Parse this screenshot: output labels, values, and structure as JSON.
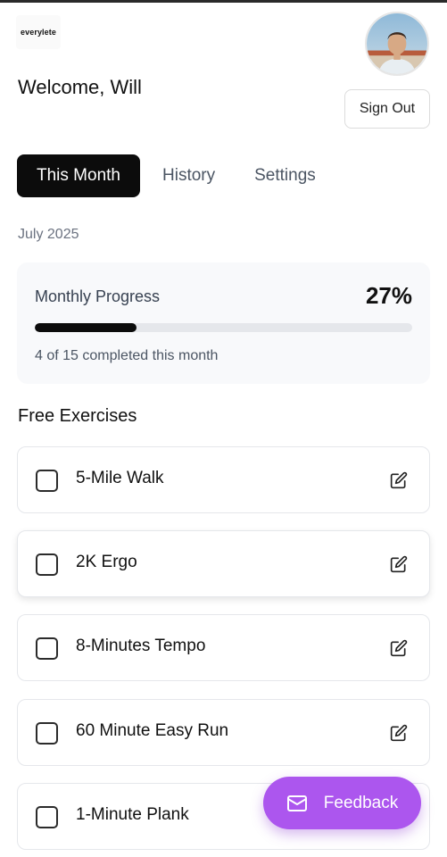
{
  "app": {
    "logo_text": "everylete"
  },
  "header": {
    "welcome": "Welcome, Will",
    "sign_out_label": "Sign Out",
    "avatar_icon": "user-avatar-photo"
  },
  "tabs": [
    {
      "label": "This Month",
      "active": true
    },
    {
      "label": "History",
      "active": false
    },
    {
      "label": "Settings",
      "active": false
    }
  ],
  "month_label": "July 2025",
  "progress": {
    "title": "Monthly Progress",
    "percent_text": "27%",
    "percent_value": 27,
    "completed_text": "4 of 15 completed this month"
  },
  "free_exercises": {
    "title": "Free Exercises",
    "items": [
      {
        "name": "5-Mile Walk",
        "checked": false,
        "icon": "edit-icon"
      },
      {
        "name": "2K Ergo",
        "checked": false,
        "icon": "edit-icon"
      },
      {
        "name": "8-Minutes Tempo",
        "checked": false,
        "icon": "edit-icon"
      },
      {
        "name": "60 Minute Easy Run",
        "checked": false,
        "icon": "edit-icon"
      },
      {
        "name": "1-Minute Plank",
        "checked": false,
        "icon": "edit-icon"
      }
    ]
  },
  "feedback": {
    "label": "Feedback",
    "icon": "mail-icon",
    "color": "#ac56ee"
  },
  "colors": {
    "accent_dark": "#0c0c0c",
    "card_bg": "#f8f9fb",
    "muted_text": "#6b7280"
  }
}
